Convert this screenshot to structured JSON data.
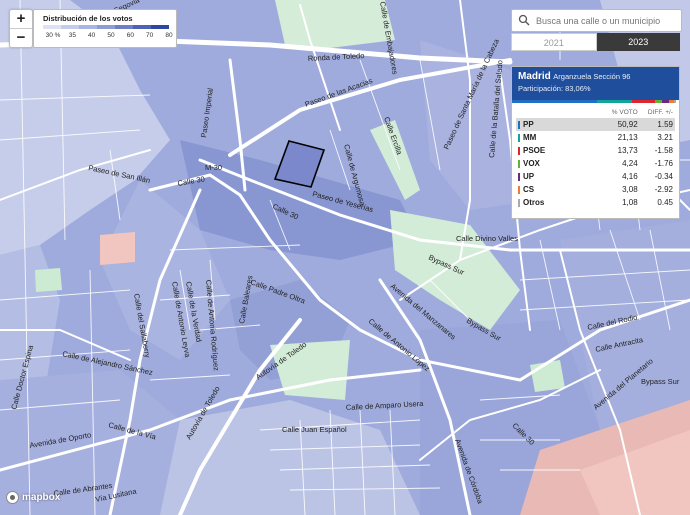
{
  "legend": {
    "title": "Distribución de los votos",
    "ticks": [
      "30 %",
      "35",
      "40",
      "50",
      "60",
      "70",
      "80"
    ],
    "colors": [
      "#dde2f3",
      "#c4cceb",
      "#a9b4e0",
      "#8e9cd5",
      "#6f7fc6",
      "#4f63b5",
      "#2e47a3"
    ]
  },
  "zoom": {
    "in": "+",
    "out": "−"
  },
  "search": {
    "placeholder": "Busca una calle o un municipio",
    "icon": "search-icon"
  },
  "years": [
    {
      "label": "2021",
      "active": false
    },
    {
      "label": "2023",
      "active": true
    }
  ],
  "panel": {
    "municipality": "Madrid",
    "section": "Arganzuela Sección 96",
    "participation": "Participación: 83,06%",
    "header_color": "#1f4e9d",
    "col_pct": "% VOTO",
    "col_diff": "DIFF. +/-",
    "results": [
      {
        "party": "PP",
        "pct": "50,92",
        "diff": "1.59",
        "color": "#1f6fc5",
        "share": 50.92
      },
      {
        "party": "MM",
        "pct": "21,13",
        "diff": "3.21",
        "color": "#13a49a",
        "share": 21.13
      },
      {
        "party": "PSOE",
        "pct": "13,73",
        "diff": "-1.58",
        "color": "#e0262d",
        "share": 13.73
      },
      {
        "party": "VOX",
        "pct": "4,24",
        "diff": "-1.76",
        "color": "#62b23a",
        "share": 4.24
      },
      {
        "party": "UP",
        "pct": "4,16",
        "diff": "-0.34",
        "color": "#6b2a7f",
        "share": 4.16
      },
      {
        "party": "CS",
        "pct": "3,08",
        "diff": "-2.92",
        "color": "#f07b2b",
        "share": 3.08
      },
      {
        "party": "Otros",
        "pct": "1,08",
        "diff": "0.45",
        "color": "#aaaaaa",
        "share": 1.08
      }
    ]
  },
  "streets": [
    "Ronda de Toledo",
    "Paseo de las Acacias",
    "Paseo Imperial",
    "Calle 30",
    "M-30",
    "Paseo de Yeserías",
    "Calle 30",
    "Calle Divino Valles",
    "Bypass Sur",
    "Bypass Sur",
    "Calle Padre Oltra",
    "Calle Baleares",
    "Autovía de Toledo",
    "Calle de Antonio López",
    "Calle de Alejandro Sánchez",
    "Calle de la Vía",
    "Avenida de Oporto",
    "Autovía de Toledo",
    "Calle Juan Español",
    "Calle de Amparo Usera",
    "Avenida de Córdoba",
    "Calle 30",
    "Avenida del Manzanares",
    "Calle del Rodio",
    "Calle Antracita",
    "Bypass Sur",
    "Avenida del Planetario",
    "Paseo de San Illán",
    "Calle de Argumosa",
    "Ronda de Segovia",
    "Calle de Embajadores",
    "Calle del Sallaberry",
    "Vía Lusitana",
    "Calle de Abrantes",
    "Calle Ercilla",
    "Paseo de Santa María de la Cabeza",
    "Calle de la Batalla del Salado",
    "Calle de Antonio Leyva",
    "Calle Doctor Espina",
    "Calle de la Verdad",
    "Calle de Antonia Rodríguez"
  ],
  "attribution": "mapbox"
}
